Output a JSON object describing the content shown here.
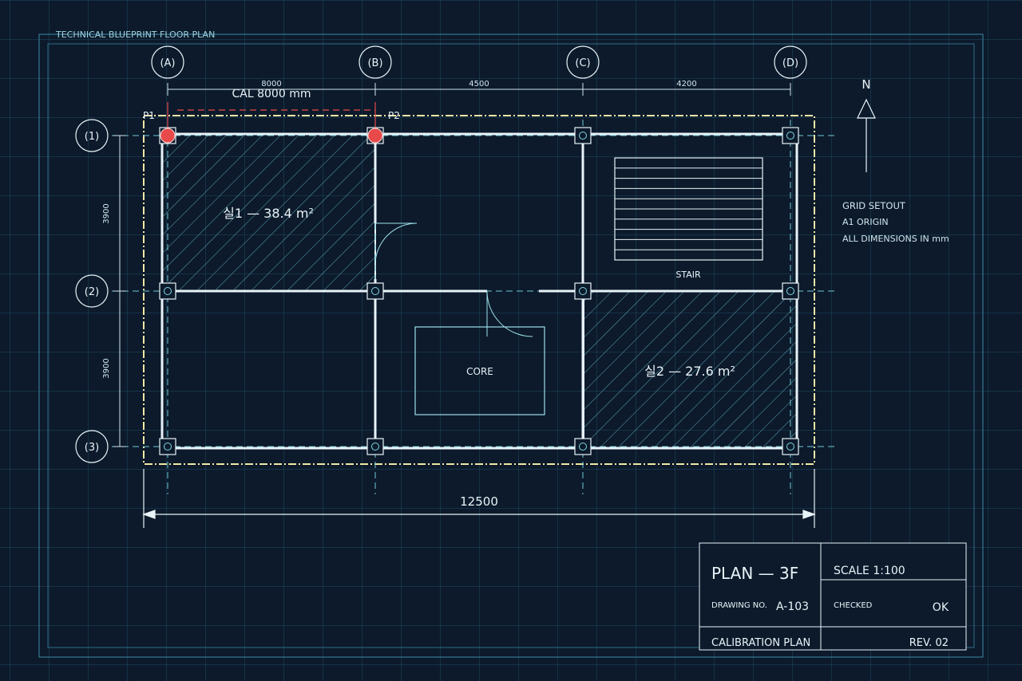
{
  "header": {
    "title": "TECHNICAL BLUEPRINT FLOOR PLAN"
  },
  "grid_axes": {
    "columns": [
      "(A)",
      "(B)",
      "(C)",
      "(D)"
    ],
    "rows": [
      "(1)",
      "(2)",
      "(3)"
    ]
  },
  "dimensions": {
    "spans": [
      "8000",
      "4500",
      "4200"
    ],
    "heights": [
      "3900",
      "3900"
    ],
    "overall": "12500"
  },
  "calibration": {
    "label": "CAL  8000 mm",
    "p1": "P1",
    "p2": "P2"
  },
  "rooms": {
    "room1": "실1 — 38.4 m²",
    "room2": "실2 — 27.6 m²",
    "core": "CORE",
    "stair": "STAIR"
  },
  "north": "N",
  "notes": [
    "GRID SETOUT",
    "A1 ORIGIN",
    "ALL DIMENSIONS IN mm"
  ],
  "title_block": {
    "plan": "PLAN — 3F",
    "scale": "SCALE 1:100",
    "drawing_no_label": "DRAWING NO.",
    "drawing_no": "A-103",
    "checked_label": "CHECKED",
    "checked": "OK",
    "name": "CALIBRATION PLAN",
    "rev": "REV. 02"
  },
  "colors": {
    "background": "#0c1a2b",
    "grid": "#1f4a63",
    "lines": "#e8f3f8",
    "cyan": "#7fd8e4",
    "calibration": "#e84a4a",
    "boundary": "#f2e8a6"
  }
}
